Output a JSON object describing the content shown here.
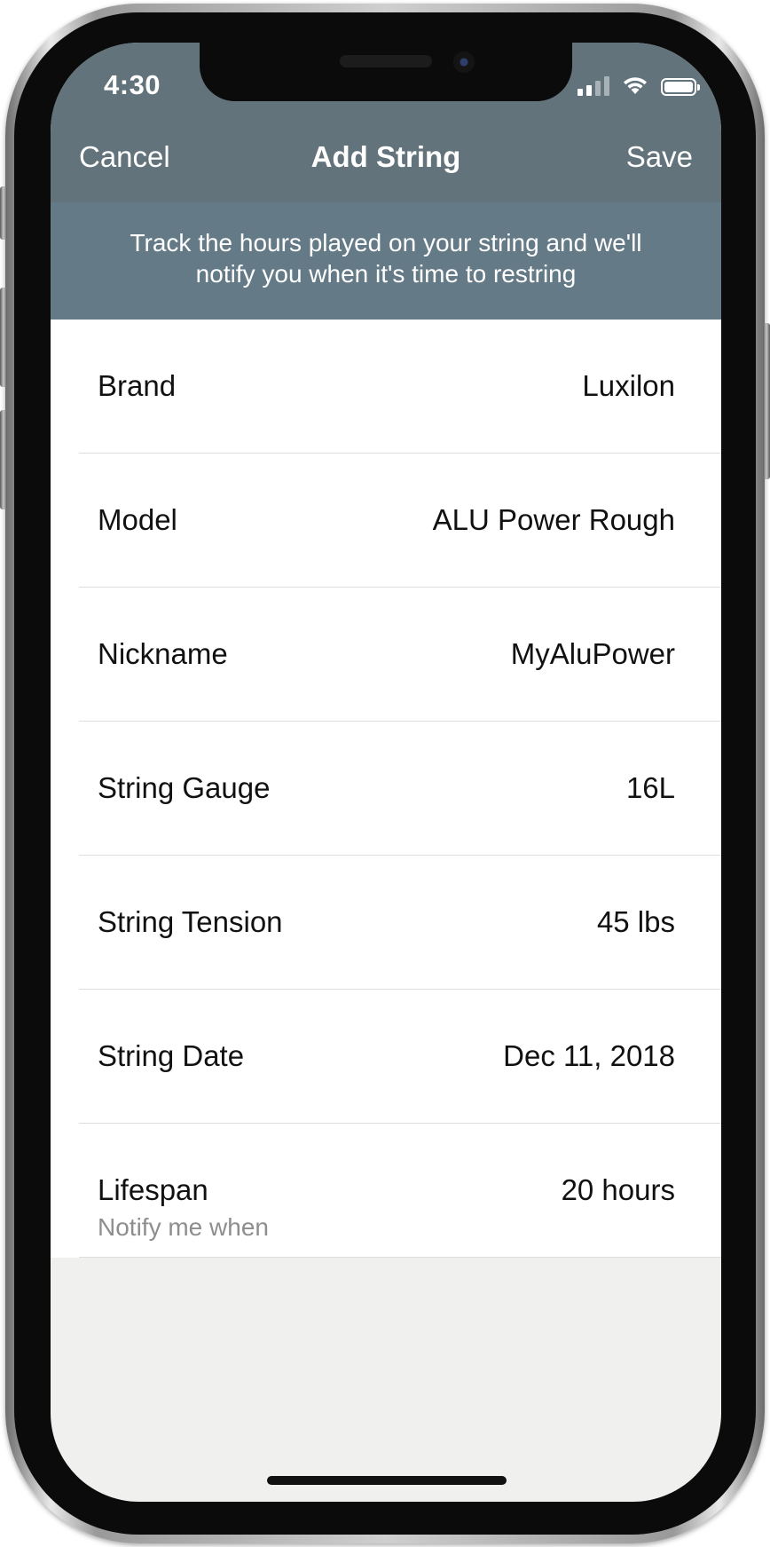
{
  "status_bar": {
    "time": "4:30",
    "signal_icon": "cellular-signal-icon",
    "wifi_icon": "wifi-icon",
    "battery_icon": "battery-icon"
  },
  "nav": {
    "cancel_label": "Cancel",
    "title": "Add String",
    "save_label": "Save"
  },
  "banner": {
    "line1": "Track the hours played on your string and we'll",
    "line2": "notify you when it's time to restring"
  },
  "form": {
    "rows": [
      {
        "label": "Brand",
        "value": "Luxilon"
      },
      {
        "label": "Model",
        "value": "ALU Power Rough"
      },
      {
        "label": "Nickname",
        "value": "MyAluPower"
      },
      {
        "label": "String Gauge",
        "value": "16L"
      },
      {
        "label": "String Tension",
        "value": "45 lbs"
      },
      {
        "label": "String Date",
        "value": "Dec 11, 2018"
      },
      {
        "label": "Lifespan",
        "value": "20 hours",
        "sublabel": "Notify me when"
      }
    ]
  },
  "colors": {
    "nav_background": "#62737b",
    "banner_background": "#647b87",
    "list_background": "#ffffff",
    "screen_background": "#f0f0ef"
  }
}
